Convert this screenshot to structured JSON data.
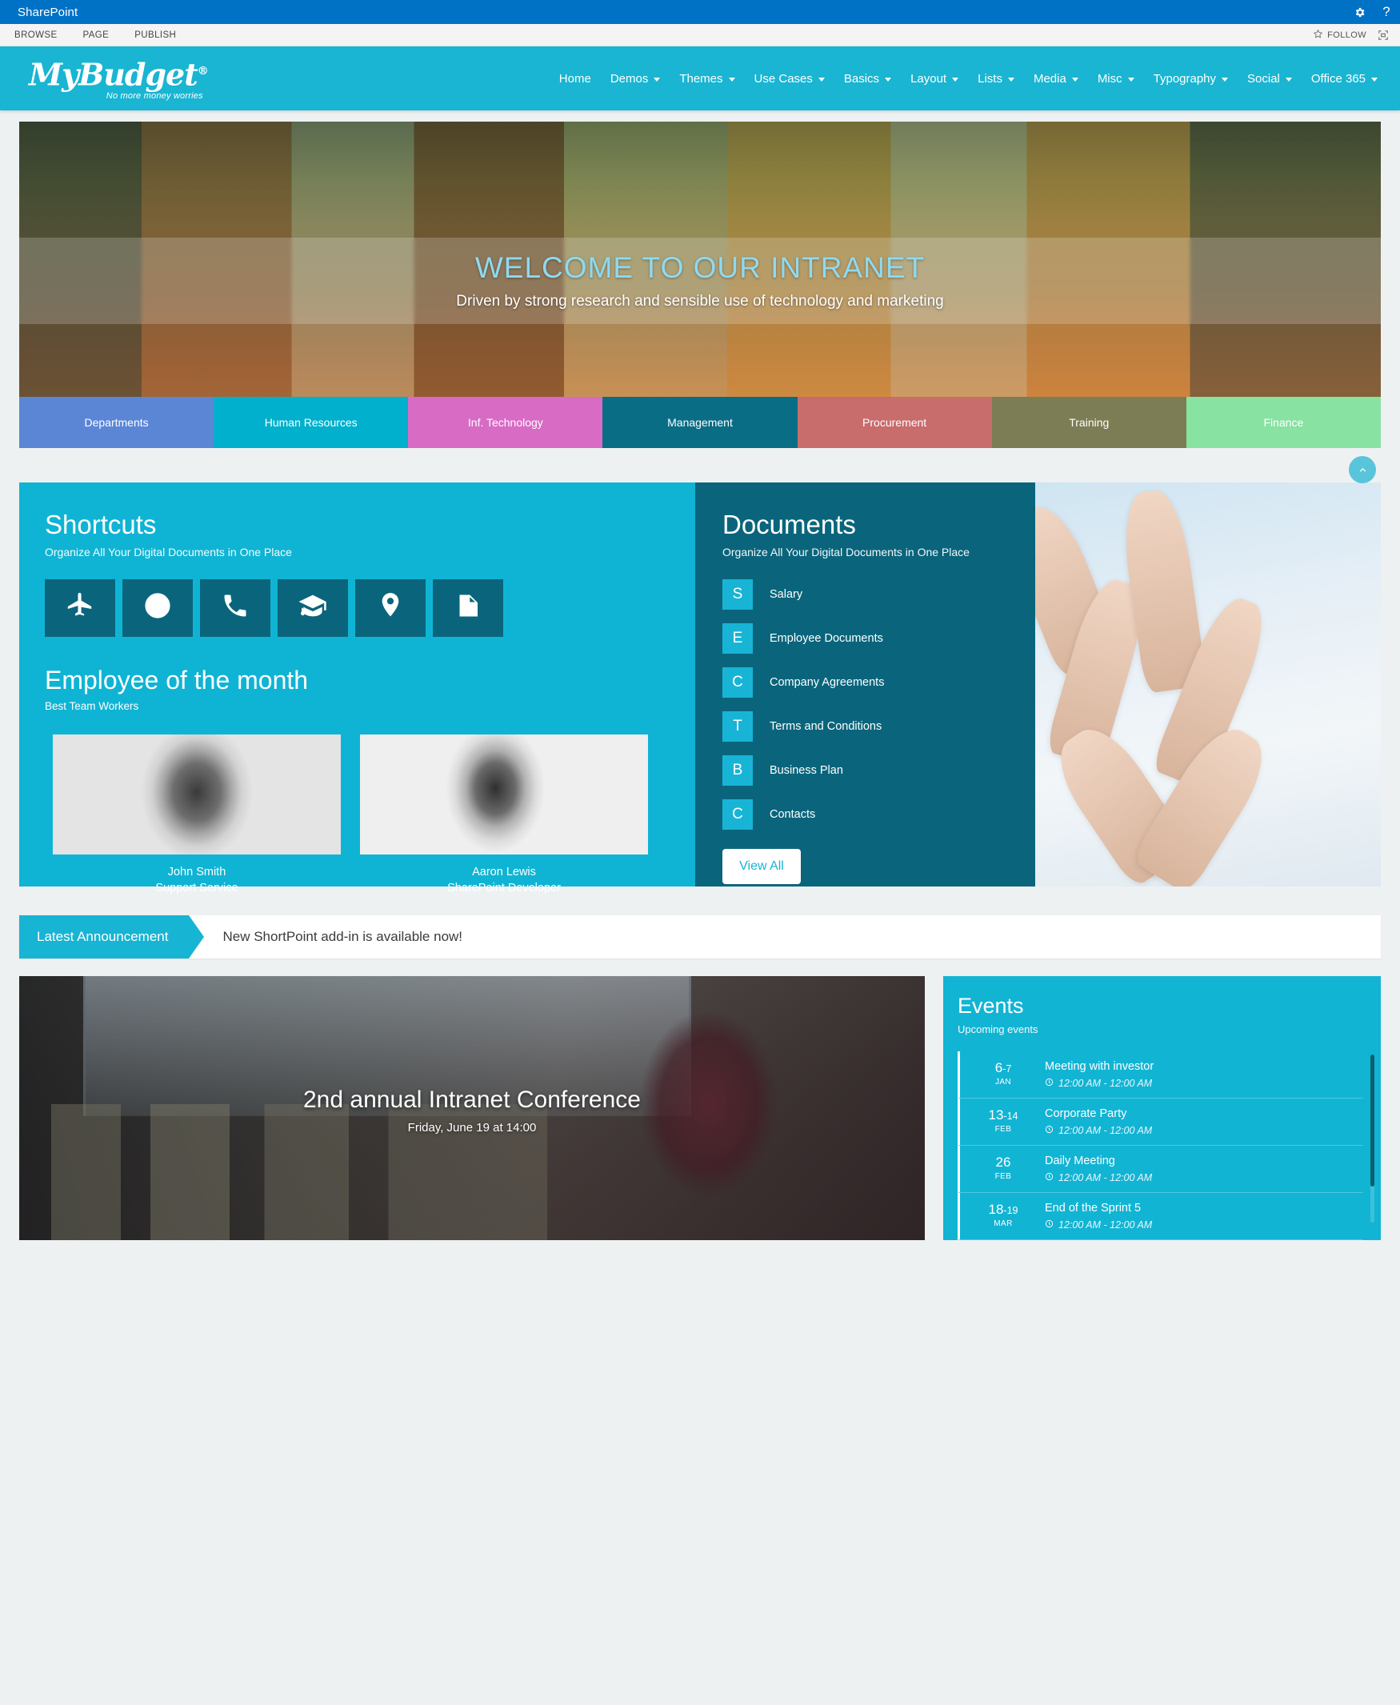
{
  "suite": {
    "brand": "SharePoint",
    "settings_icon": "gear-icon",
    "help_icon": "help-icon"
  },
  "ribbon": {
    "tabs": [
      "BROWSE",
      "PAGE",
      "PUBLISH"
    ],
    "follow_label": "FOLLOW",
    "follow_icon": "star-icon",
    "focus_icon": "focus-on-content-icon"
  },
  "site_nav": {
    "logo_text": "MyBudget",
    "logo_reg": "®",
    "logo_tagline": "No more money worries",
    "items": [
      {
        "label": "Home",
        "has_caret": false
      },
      {
        "label": "Demos",
        "has_caret": true
      },
      {
        "label": "Themes",
        "has_caret": true
      },
      {
        "label": "Use Cases",
        "has_caret": true
      },
      {
        "label": "Basics",
        "has_caret": true
      },
      {
        "label": "Layout",
        "has_caret": true
      },
      {
        "label": "Lists",
        "has_caret": true
      },
      {
        "label": "Media",
        "has_caret": true
      },
      {
        "label": "Misc",
        "has_caret": true
      },
      {
        "label": "Typography",
        "has_caret": true
      },
      {
        "label": "Social",
        "has_caret": true
      },
      {
        "label": "Office 365",
        "has_caret": true
      }
    ]
  },
  "hero": {
    "title": "WELCOME TO OUR INTRANET",
    "subtitle": "Driven by strong research and sensible use of technology and marketing",
    "edit_icon": "pencil-icon"
  },
  "departments": [
    {
      "label": "Departments",
      "color": "#5b86d6"
    },
    {
      "label": "Human Resources",
      "color": "#00b0cd"
    },
    {
      "label": "Inf. Technology",
      "color": "#d濃",
      "hex": "#d86bc4"
    },
    {
      "label": "Management",
      "color": "#0a6d86"
    },
    {
      "label": "Procurement",
      "color": "#c96c6c"
    },
    {
      "label": "Training",
      "color": "#7c7d54"
    },
    {
      "label": "Finance",
      "color": "#88e2a2"
    }
  ],
  "scroll_top_icon": "chevron-up-icon",
  "shortcuts": {
    "title": "Shortcuts",
    "subtitle": "Organize All Your Digital Documents in One Place",
    "icons": [
      "airplane-icon",
      "life-buoy-icon",
      "phone-icon",
      "graduation-cap-icon",
      "location-pin-icon",
      "document-icon"
    ]
  },
  "employee_of_month": {
    "title": "Employee of the month",
    "subtitle": "Best Team Workers",
    "people": [
      {
        "name": "John Smith",
        "role": "Support Service"
      },
      {
        "name": "Aaron Lewis",
        "role": "SharePoint Developer"
      }
    ]
  },
  "documents": {
    "title": "Documents",
    "subtitle": "Organize All Your Digital Documents in One Place",
    "items": [
      {
        "badge": "S",
        "label": "Salary"
      },
      {
        "badge": "E",
        "label": "Employee Documents"
      },
      {
        "badge": "C",
        "label": "Company Agreements"
      },
      {
        "badge": "T",
        "label": "Terms and Conditions"
      },
      {
        "badge": "B",
        "label": "Business Plan"
      },
      {
        "badge": "C",
        "label": "Contacts"
      }
    ],
    "view_all_label": "View All"
  },
  "announcement": {
    "tag": "Latest Announcement",
    "text": "New ShortPoint add-in is available now!"
  },
  "conference": {
    "title": "2nd annual Intranet Conference",
    "date": "Friday, June 19 at 14:00"
  },
  "events": {
    "title": "Events",
    "subtitle": "Upcoming events",
    "clock_icon": "clock-icon",
    "items": [
      {
        "day": "6",
        "day_end": "-7",
        "month": "JAN",
        "name": "Meeting with investor",
        "time": "12:00 AM - 12:00 AM"
      },
      {
        "day": "13",
        "day_end": "-14",
        "month": "FEB",
        "name": "Corporate Party",
        "time": "12:00 AM - 12:00 AM"
      },
      {
        "day": "26",
        "day_end": "",
        "month": "FEB",
        "name": "Daily Meeting",
        "time": "12:00 AM - 12:00 AM"
      },
      {
        "day": "18",
        "day_end": "-19",
        "month": "MAR",
        "name": "End of the Sprint 5",
        "time": "12:00 AM - 12:00 AM"
      }
    ]
  },
  "colors": {
    "sharepoint_blue": "#0072c6",
    "brand_cyan": "#19b5d2",
    "panel_cyan": "#0fb4d4",
    "panel_teal": "#0a657c",
    "badge_cyan": "#18b4d6"
  }
}
